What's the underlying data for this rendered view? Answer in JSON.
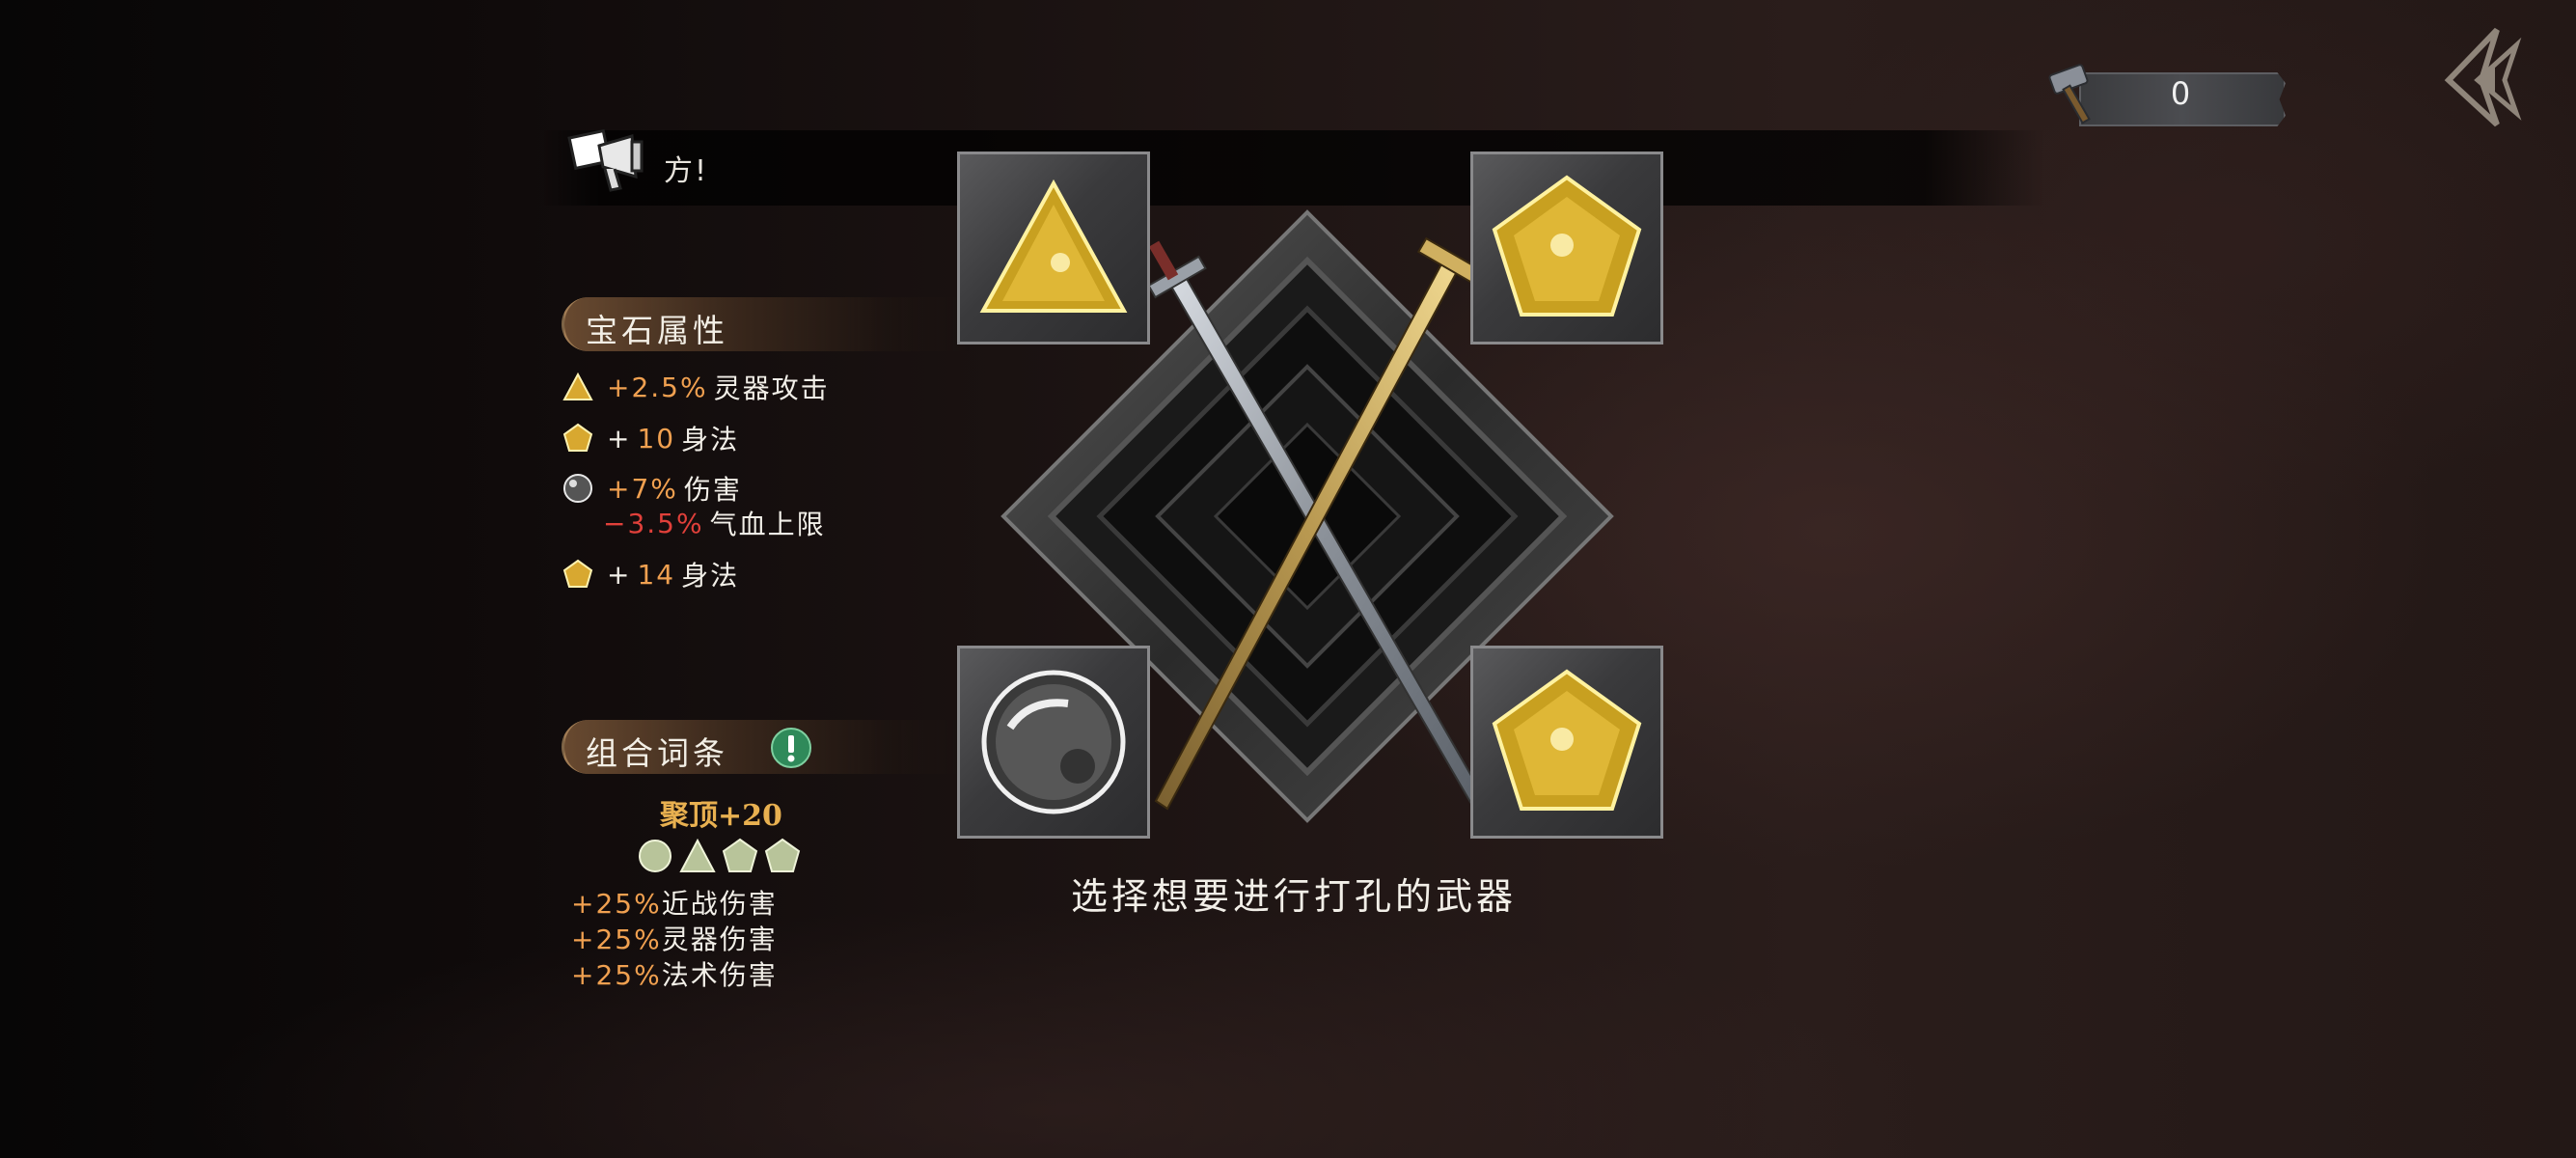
{
  "notice": {
    "text": "方!"
  },
  "counter": {
    "value": "0"
  },
  "gem_attributes": {
    "title": "宝石属性",
    "lines": [
      {
        "shape": "triangle",
        "value": "+2.5%",
        "label": "灵器攻击"
      },
      {
        "shape": "pentagon",
        "prefix": "+ ",
        "value": "10",
        "label": "身法"
      },
      {
        "shape": "circle",
        "value": "+7%",
        "label": "伤害",
        "value2": "−3.5%",
        "label2": "气血上限"
      },
      {
        "shape": "pentagon",
        "prefix": "+ ",
        "value": "14",
        "label": "身法"
      }
    ]
  },
  "combo": {
    "title": "组合词条",
    "name": "聚顶+20",
    "effects": [
      {
        "value": "+25%",
        "label": "近战伤害"
      },
      {
        "value": "+25%",
        "label": "灵器伤害"
      },
      {
        "value": "+25%",
        "label": "法术伤害"
      }
    ]
  },
  "slots": {
    "top_left": "triangle-gem",
    "top_right": "pentagon-gem",
    "bottom_left": "circle-gem",
    "bottom_right": "pentagon-gem"
  },
  "hint": "选择想要进行打孔的武器",
  "colors": {
    "accent_orange": "#f0a050",
    "negative_red": "#e0403a",
    "gold": "#e8b050"
  }
}
